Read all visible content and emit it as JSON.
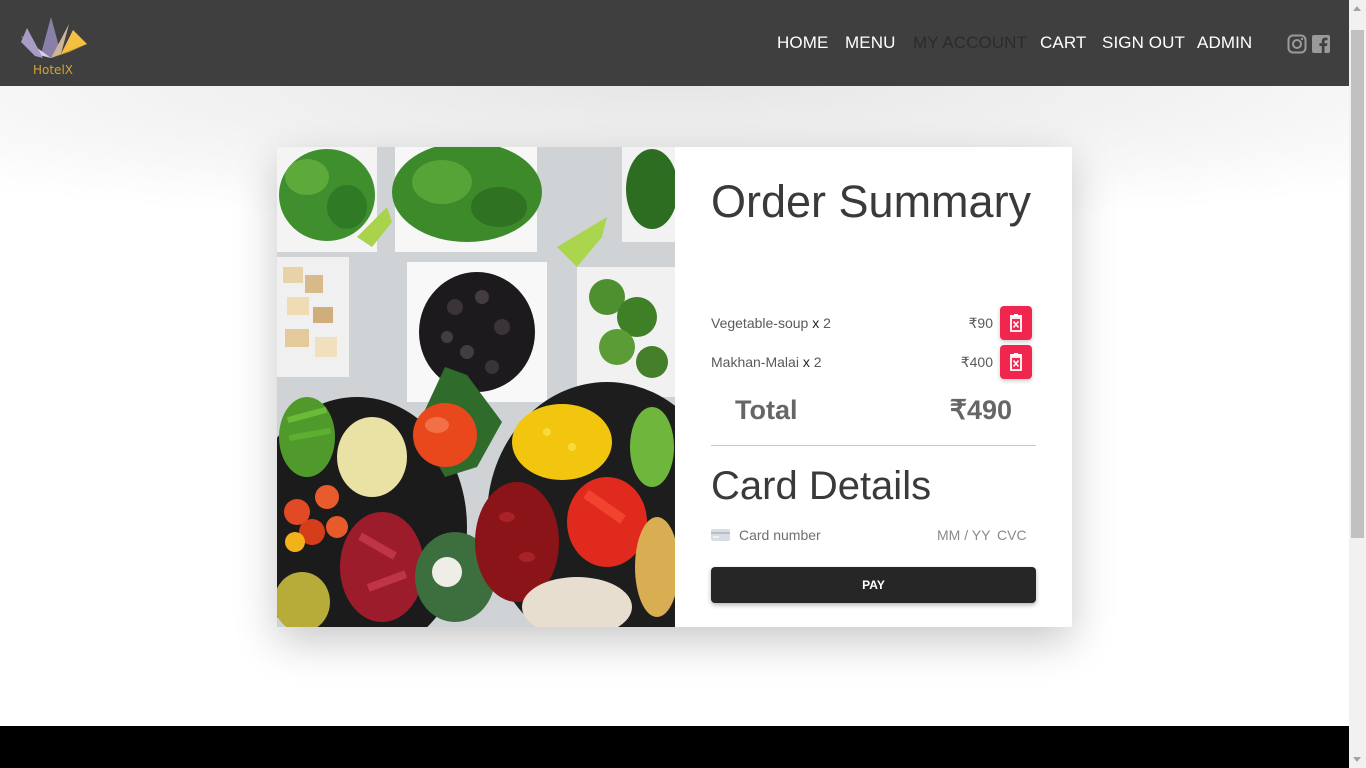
{
  "brand": {
    "name": "HotelX"
  },
  "nav": [
    {
      "label": "HOME",
      "active": false
    },
    {
      "label": "MENU",
      "active": false
    },
    {
      "label": "MY ACCOUNT",
      "active": true
    },
    {
      "label": "CART",
      "active": false
    },
    {
      "label": "SIGN OUT",
      "active": false
    },
    {
      "label": "ADMIN",
      "active": false
    }
  ],
  "social": [
    "instagram-icon",
    "facebook-icon"
  ],
  "order": {
    "title": "Order Summary",
    "items": [
      {
        "name": "Vegetable-soup",
        "sep": "x",
        "qty": "2",
        "price": "₹90"
      },
      {
        "name": "Makhan-Malai",
        "sep": "x",
        "qty": "2",
        "price": "₹400"
      }
    ],
    "total_label": "Total",
    "total_value": "₹490"
  },
  "payment": {
    "title": "Card Details",
    "card_placeholder": "Card number",
    "expiry_placeholder": "MM / YY",
    "cvc_placeholder": "CVC",
    "pay_label": "PAY"
  },
  "colors": {
    "navbar": "#3f3f3f",
    "accent_delete": "#f0264e",
    "pay_button": "#262626",
    "logo_gold": "#d4a437"
  }
}
